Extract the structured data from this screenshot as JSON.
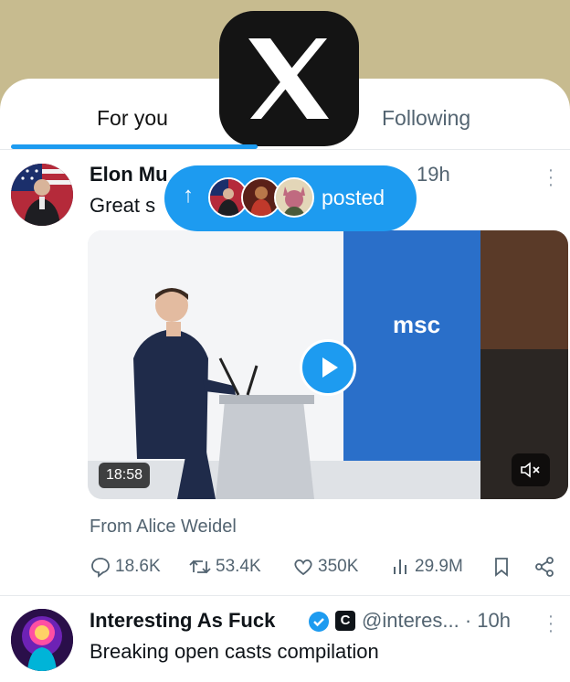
{
  "tabs": [
    {
      "label": "For you",
      "active": true
    },
    {
      "label": "Following",
      "active": false
    }
  ],
  "logo": {
    "icon": "x-logo-icon"
  },
  "post1": {
    "author": "Elon Mu",
    "time": "19h",
    "text": "Great s",
    "media": {
      "duration": "18:58",
      "sign": "msc",
      "play_icon": "play-icon",
      "mute_icon": "muted-speaker-icon"
    },
    "from": "From Alice Weidel",
    "stats": {
      "replies": "18.6K",
      "reposts": "53.4K",
      "likes": "350K",
      "views": "29.9M"
    }
  },
  "posted_pill": {
    "arrow": "↑",
    "label": "posted"
  },
  "post2": {
    "author": "Interesting As Fuck",
    "badge": "C",
    "handle": "@interes...",
    "time": "· 10h",
    "text": "Breaking open casts compilation"
  },
  "colors": {
    "accent": "#1d9bf0",
    "muted": "#536471",
    "header_bg": "#c7bb8f"
  }
}
